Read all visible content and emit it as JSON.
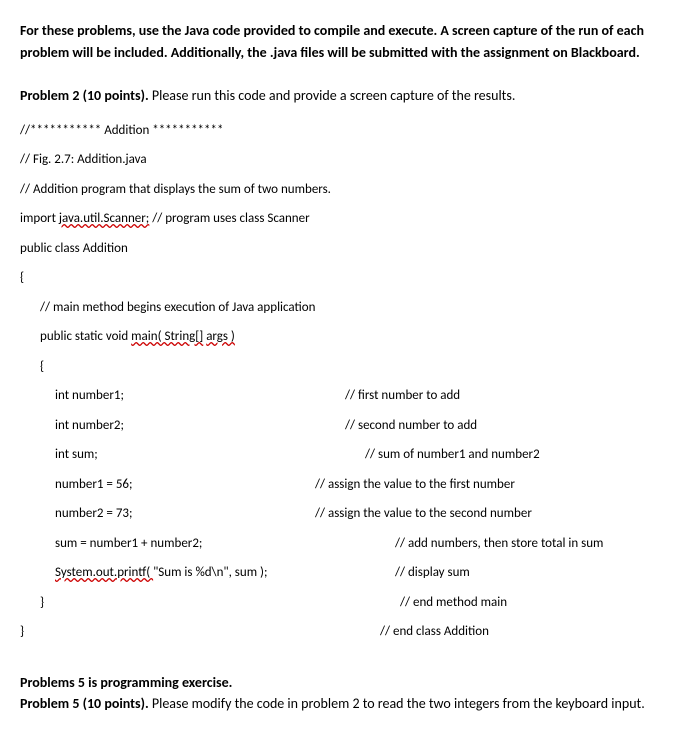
{
  "intro": "For these problems, use the Java code provided to compile and execute.   A screen capture of the run of each problem will be included.  Additionally, the .java files will be submitted with the assignment on Blackboard.",
  "problem2": {
    "title": "Problem 2 (10 points).",
    "desc": "  Please run this code and provide a screen capture of the results."
  },
  "code": {
    "l1": "//*********** Addition ***********",
    "l2": "// Fig. 2.7: Addition.java",
    "l3": "// Addition program that displays the sum of two numbers.",
    "l4a": "import ",
    "l4b": "java.util.Scanner;",
    "l4c": " // program uses class Scanner",
    "l5": "public class Addition",
    "l6": "{",
    "l7": "// main method begins execution of Java application",
    "l8a": "public static void ",
    "l8b": "main( String[]",
    "l8c": " ",
    "l8d": "args )",
    "l9": "{",
    "l10a": "int number1;",
    "l10b": "// first number to add",
    "l11a": "int number2;",
    "l11b": "// second number to add",
    "l12a": "int sum;",
    "l12b": "// sum of number1 and number2",
    "l13a": "number1 = 56;",
    "l13b": "// assign the value to the first number",
    "l14a": "number2 = 73;",
    "l14b": "// assign the value to the second number",
    "l15a": "sum = number1 + number2;",
    "l15b": "// add numbers, then store total in sum",
    "l16a": "System.out.printf( ",
    "l16b": "\"Sum is %d\\n\", sum );",
    "l16c": "// display sum",
    "l17a": "}",
    "l17b": "// end method main",
    "l18a": "}",
    "l18b": "// end class Addition"
  },
  "problem5": {
    "intro": "Problems 5 is programming exercise.",
    "title": "Problem 5 (10 points).",
    "desc": "  Please modify the code in problem 2 to read the two integers from the keyboard input."
  }
}
